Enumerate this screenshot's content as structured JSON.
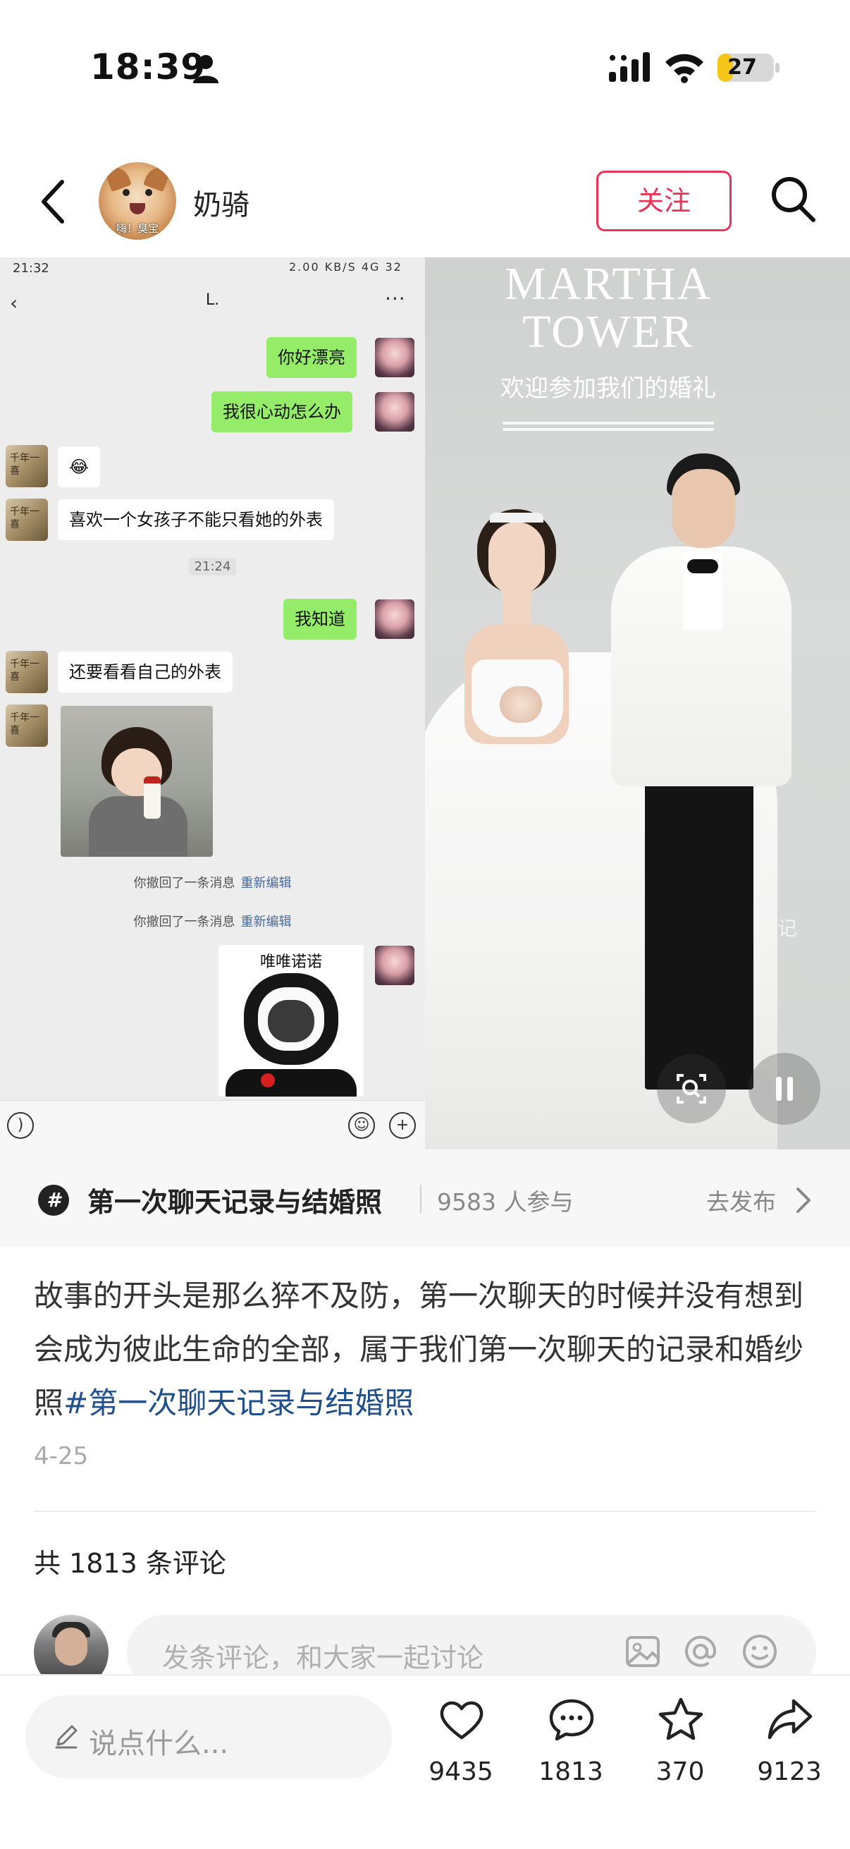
{
  "status_bar": {
    "time": "18:39",
    "battery": "27",
    "battery_level": 0.27
  },
  "nav": {
    "back_icon": "back-arrow-icon",
    "author_name": "奶骑",
    "avatar_caption": "嗨！臭宝",
    "follow_label": "关注",
    "search_icon": "search-icon"
  },
  "chat_screenshot": {
    "status_time": "21:32",
    "status_info": "2.00 KB/S 4G 32",
    "title": "L.",
    "more": "···",
    "messages": {
      "m1": "你好漂亮",
      "m2": "我很心动怎么办",
      "m3": "😂",
      "m4": "喜欢一个女孩子不能只看她的外表",
      "time2": "21:24",
      "m5": "我知道",
      "m6": "还要看看自己的外表"
    },
    "other_avatar_text": "千年一喜",
    "recall_1": "你撤回了一条消息",
    "recall_2": "你撤回了一条消息",
    "re_edit": "重新编辑",
    "sticker_text": "唯唯诺诺"
  },
  "wedding_photo": {
    "title_line1": "MARTHA",
    "title_line2": "TOWER",
    "subtitle": "欢迎参加我们的婚礼",
    "watermark": "记"
  },
  "topic": {
    "hash": "#",
    "title": "第一次聊天记录与结婚照",
    "count": "9583 人参与",
    "publish": "去发布"
  },
  "post": {
    "text": "故事的开头是那么猝不及防，第一次聊天的时候并没有想到会成为彼此生命的全部，属于我们第一次聊天的记录和婚纱照",
    "hashtag": "#第一次聊天记录与结婚照",
    "date": "4-25"
  },
  "comments": {
    "count_label": "共 1813 条评论",
    "placeholder": "发条评论，和大家一起讨论"
  },
  "bottom_bar": {
    "say_placeholder": "说点什么...",
    "likes": "9435",
    "comments": "1813",
    "favorites": "370",
    "shares": "9123"
  },
  "colors": {
    "accent": "#e93358",
    "hashtag": "#1f4f8c",
    "chat_green": "#95ec69"
  }
}
